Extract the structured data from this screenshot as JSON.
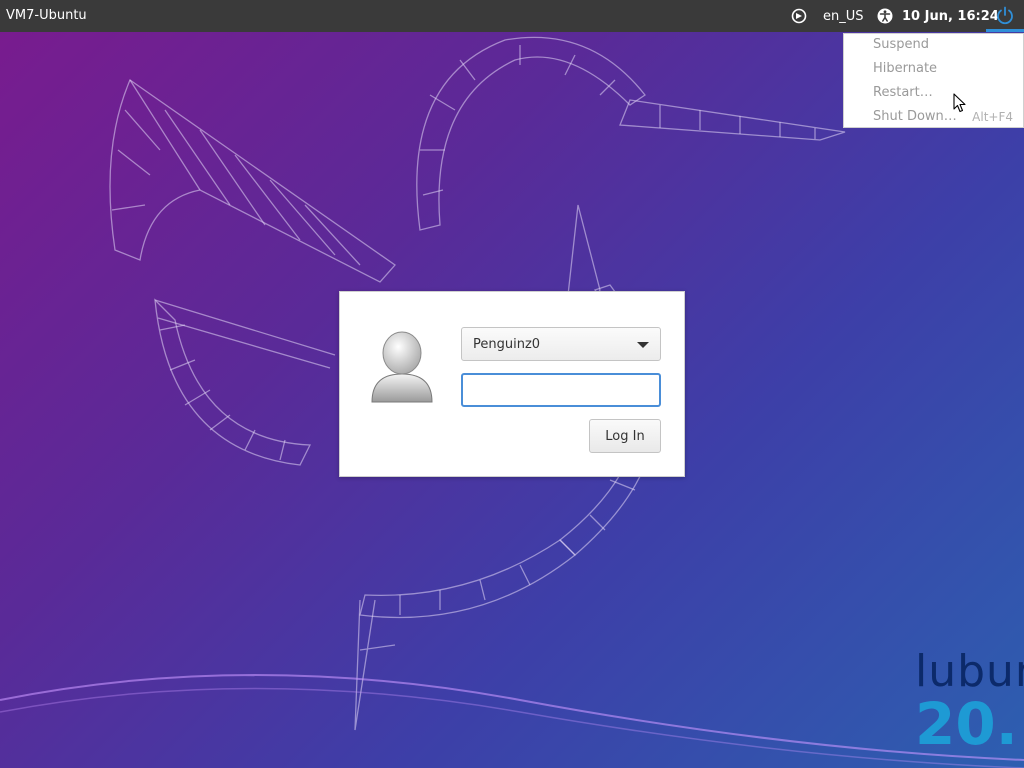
{
  "topbar": {
    "host_name": "VM7-Ubuntu",
    "keyboard_layout": "en_US",
    "clock": "10 Jun, 16:24",
    "icons": [
      "session-icon",
      "accessibility-icon",
      "power-icon"
    ]
  },
  "power_menu": {
    "items": [
      {
        "label": "Suspend",
        "accelerator": ""
      },
      {
        "label": "Hibernate",
        "accelerator": ""
      },
      {
        "label": "Restart…",
        "accelerator": ""
      },
      {
        "label": "Shut Down…",
        "accelerator": "Alt+F4"
      }
    ]
  },
  "login": {
    "selected_user": "Penguinz0",
    "password_value": "",
    "login_button": "Log In"
  },
  "branding": {
    "name": "lubun",
    "version": "20."
  },
  "colors": {
    "topbar_bg": "#3a3a3a",
    "focus_accent": "#4a8ed8",
    "power_active": "#2f8fd8",
    "brand_dark": "#0c2a6a",
    "brand_light": "#1e9ad4"
  }
}
